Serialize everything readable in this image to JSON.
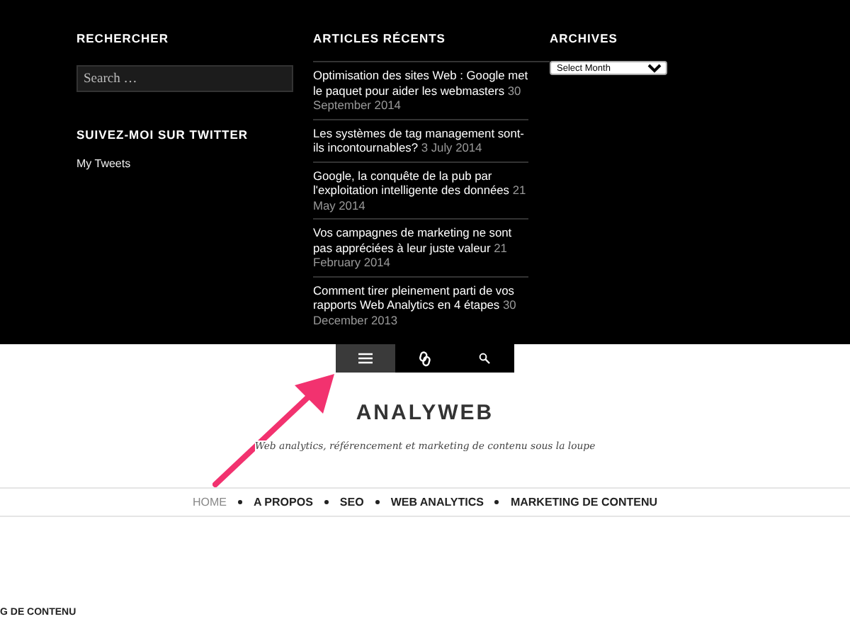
{
  "footer_widgets": {
    "search": {
      "heading": "RECHERCHER",
      "placeholder": "Search …"
    },
    "twitter": {
      "heading": "SUIVEZ-MOI SUR TWITTER",
      "link": "My Tweets"
    },
    "recent": {
      "heading": "ARTICLES RÉCENTS",
      "articles": [
        {
          "title": "Optimisation des sites Web : Google met le paquet pour aider les webmasters",
          "date": "30 September 2014"
        },
        {
          "title": "Les systèmes de tag management sont-ils incontournables?",
          "date": "3 July 2014"
        },
        {
          "title": "Google, la conquête de la pub par l'exploitation intelligente des données",
          "date": "21 May 2014"
        },
        {
          "title": "Vos campagnes de marketing ne sont pas appréciées à leur juste valeur",
          "date": "21 February 2014"
        },
        {
          "title": "Comment tirer pleinement parti de vos rapports Web Analytics en 4 étapes",
          "date": "30 December 2013"
        }
      ]
    },
    "archives": {
      "heading": "ARCHIVES",
      "select": "Select Month"
    }
  },
  "toolbar": [
    {
      "kind": "menu",
      "selected": true
    },
    {
      "kind": "link",
      "selected": false
    },
    {
      "kind": "search",
      "selected": false
    }
  ],
  "site": {
    "title": "ANALYWEB",
    "tagline": "Web analytics, référencement et marketing de contenu sous la loupe"
  },
  "nav": [
    {
      "label": "HOME",
      "selected": true
    },
    {
      "label": "A PROPOS",
      "selected": false
    },
    {
      "label": "SEO",
      "selected": false
    },
    {
      "label": "WEB ANALYTICS",
      "selected": false
    },
    {
      "label": "MARKETING DE CONTENU",
      "selected": false
    }
  ],
  "category": "G DE CONTENU"
}
